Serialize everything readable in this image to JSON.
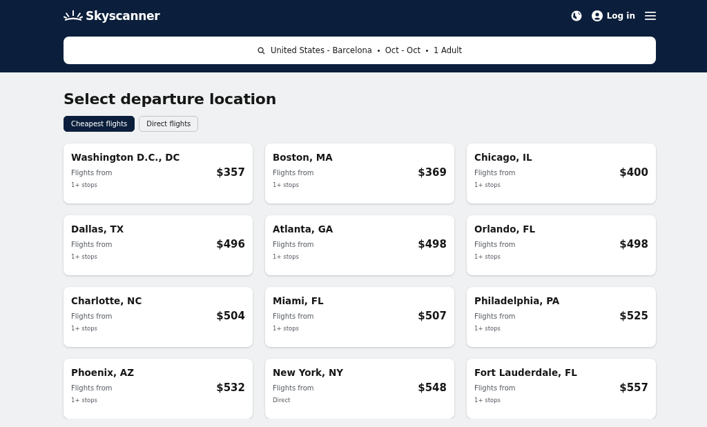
{
  "header": {
    "brand": "Skyscanner",
    "login": "Log in"
  },
  "search": {
    "parts": [
      "United States - Barcelona",
      "Oct - Oct",
      "1 Adult"
    ]
  },
  "title": "Select departure location",
  "tabs": [
    {
      "label": "Cheapest flights",
      "selected": true
    },
    {
      "label": "Direct flights",
      "selected": false
    }
  ],
  "cards": [
    {
      "city": "Washington D.C., DC",
      "from": "Flights from",
      "price": "$357",
      "stops": "1+ stops"
    },
    {
      "city": "Boston, MA",
      "from": "Flights from",
      "price": "$369",
      "stops": "1+ stops"
    },
    {
      "city": "Chicago, IL",
      "from": "Flights from",
      "price": "$400",
      "stops": "1+ stops"
    },
    {
      "city": "Dallas, TX",
      "from": "Flights from",
      "price": "$496",
      "stops": "1+ stops"
    },
    {
      "city": "Atlanta, GA",
      "from": "Flights from",
      "price": "$498",
      "stops": "1+ stops"
    },
    {
      "city": "Orlando, FL",
      "from": "Flights from",
      "price": "$498",
      "stops": "1+ stops"
    },
    {
      "city": "Charlotte, NC",
      "from": "Flights from",
      "price": "$504",
      "stops": "1+ stops"
    },
    {
      "city": "Miami, FL",
      "from": "Flights from",
      "price": "$507",
      "stops": "1+ stops"
    },
    {
      "city": "Philadelphia, PA",
      "from": "Flights from",
      "price": "$525",
      "stops": "1+ stops"
    },
    {
      "city": "Phoenix, AZ",
      "from": "Flights from",
      "price": "$532",
      "stops": "1+ stops"
    },
    {
      "city": "New York, NY",
      "from": "Flights from",
      "price": "$548",
      "stops": "Direct"
    },
    {
      "city": "Fort Lauderdale, FL",
      "from": "Flights from",
      "price": "$557",
      "stops": "1+ stops"
    }
  ]
}
